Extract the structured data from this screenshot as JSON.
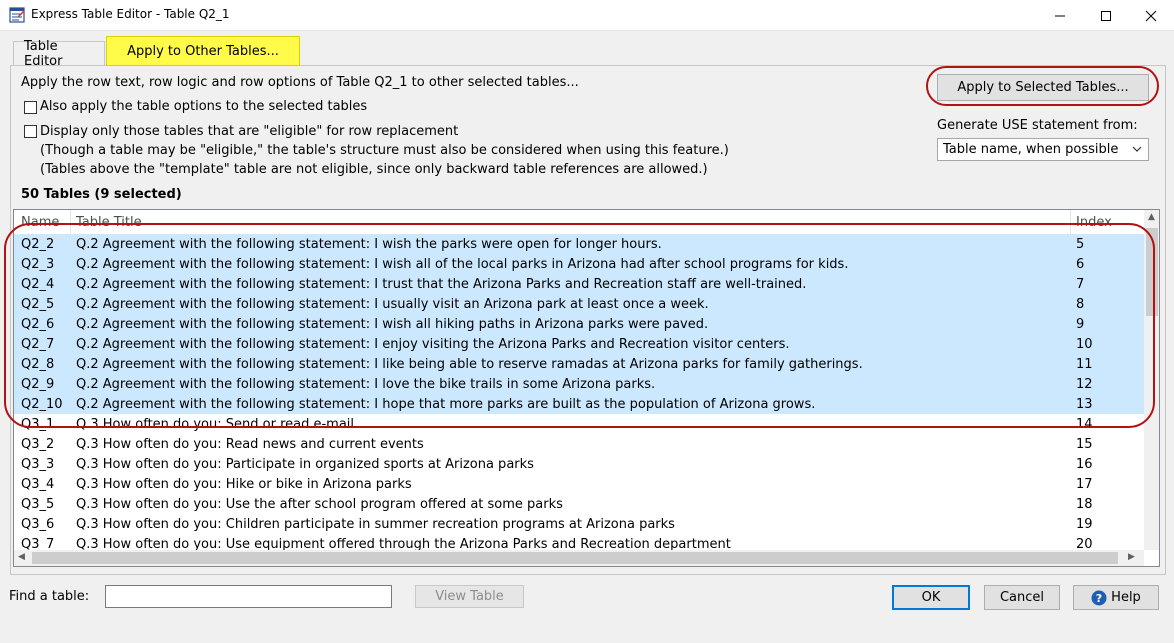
{
  "window": {
    "title": "Express Table Editor - Table Q2_1",
    "minimize_glyph": "—",
    "maximize_glyph": "☐",
    "close_glyph": "✕"
  },
  "tabs": {
    "editor": "Table Editor",
    "apply": "Apply to Other Tables..."
  },
  "options": {
    "intro": "Apply the row text, row logic and row options of Table Q2_1 to other selected tables...",
    "also_apply_label": "Also apply the table options to the selected tables",
    "also_apply_checked": false,
    "eligible_label": "Display only those tables that are \"eligible\" for row replacement",
    "eligible_checked": false,
    "note1": "(Though a table may be \"eligible,\" the table's structure must also be considered when using this feature.)",
    "note2": "(Tables above the \"template\" table are not eligible, since only backward table references are allowed.)"
  },
  "apply_button": "Apply to Selected Tables...",
  "generate": {
    "label": "Generate USE statement from:",
    "selected": "Table name, when possible"
  },
  "summary": "50 Tables  (9 selected)",
  "columns": {
    "name": "Name",
    "title": "Table Title",
    "index": "Index"
  },
  "rows": [
    {
      "name": "Q2_2",
      "title": "Q.2 Agreement with the following statement: I wish the parks were open for longer hours.",
      "index": "5",
      "selected": true
    },
    {
      "name": "Q2_3",
      "title": "Q.2 Agreement with the following statement: I wish all of the local parks in Arizona had after school programs for kids.",
      "index": "6",
      "selected": true
    },
    {
      "name": "Q2_4",
      "title": "Q.2 Agreement with the following statement: I trust that the Arizona Parks and Recreation staff are well-trained.",
      "index": "7",
      "selected": true
    },
    {
      "name": "Q2_5",
      "title": "Q.2 Agreement with the following statement: I usually visit an Arizona park at least once a week.",
      "index": "8",
      "selected": true
    },
    {
      "name": "Q2_6",
      "title": "Q.2 Agreement with the following statement: I wish all hiking paths in Arizona parks were paved.",
      "index": "9",
      "selected": true
    },
    {
      "name": "Q2_7",
      "title": "Q.2 Agreement with the following statement: I enjoy visiting the Arizona Parks and Recreation visitor centers.",
      "index": "10",
      "selected": true
    },
    {
      "name": "Q2_8",
      "title": "Q.2 Agreement with the following statement: I like being able to reserve ramadas at Arizona parks for family gatherings.",
      "index": "11",
      "selected": true
    },
    {
      "name": "Q2_9",
      "title": "Q.2 Agreement with the following statement: I love the bike trails in some Arizona parks.",
      "index": "12",
      "selected": true
    },
    {
      "name": "Q2_10",
      "title": "Q.2 Agreement with the following statement: I hope that more parks are built as the population of Arizona grows.",
      "index": "13",
      "selected": true
    },
    {
      "name": "Q3_1",
      "title": "Q.3 How often do you: Send or read e-mail",
      "index": "14",
      "selected": false
    },
    {
      "name": "Q3_2",
      "title": "Q.3 How often do you: Read news and current events",
      "index": "15",
      "selected": false
    },
    {
      "name": "Q3_3",
      "title": "Q.3 How often do you: Participate in organized sports at Arizona parks",
      "index": "16",
      "selected": false
    },
    {
      "name": "Q3_4",
      "title": "Q.3 How often do you: Hike or bike in Arizona parks",
      "index": "17",
      "selected": false
    },
    {
      "name": "Q3_5",
      "title": "Q.3 How often do you: Use the after school program offered at some parks",
      "index": "18",
      "selected": false
    },
    {
      "name": "Q3_6",
      "title": "Q.3 How often do you: Children participate in summer recreation programs at Arizona parks",
      "index": "19",
      "selected": false
    },
    {
      "name": "Q3_7",
      "title": "Q.3 How often do you: Use equipment offered through the Arizona Parks and Recreation department",
      "index": "20",
      "selected": false
    }
  ],
  "bottom": {
    "find_label": "Find a table:",
    "find_value": "",
    "view_table": "View Table",
    "ok": "OK",
    "cancel": "Cancel",
    "help": "Help"
  },
  "colors": {
    "highlight_tab": "#fffb48",
    "selected_row": "#cce8ff",
    "annotation_red": "#b31212",
    "ok_border": "#0078d7"
  }
}
